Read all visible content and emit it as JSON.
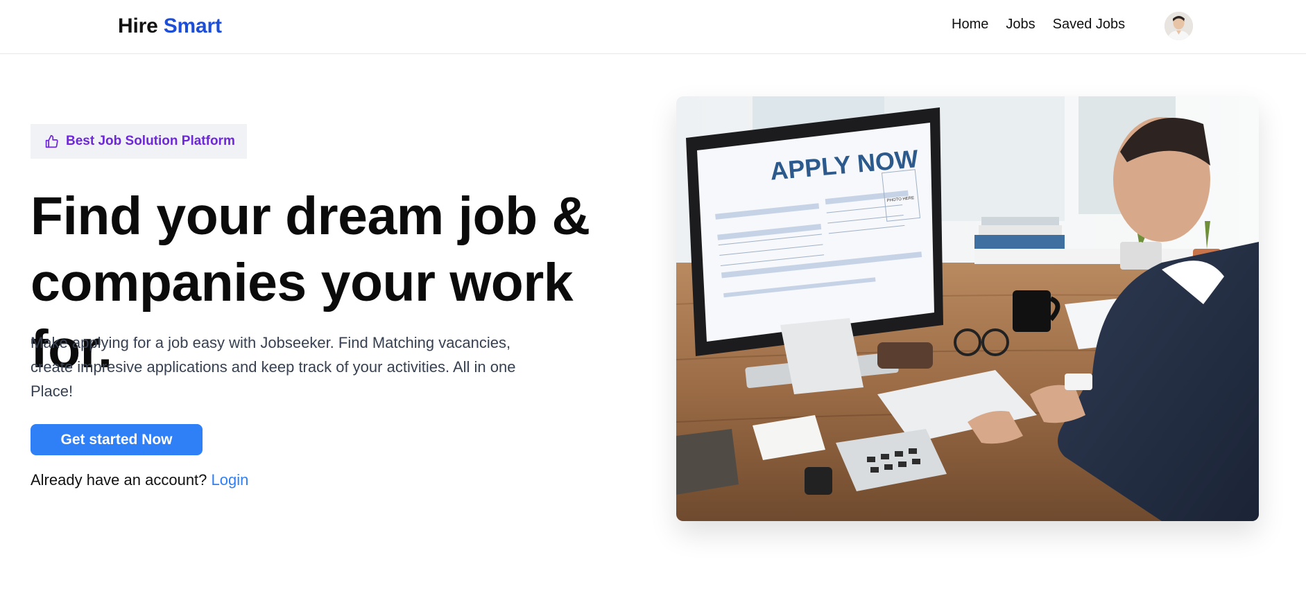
{
  "header": {
    "brand_part1": "Hire",
    "brand_part2": "Smart",
    "nav": [
      {
        "label": "Home"
      },
      {
        "label": "Jobs"
      },
      {
        "label": "Saved Jobs"
      }
    ],
    "avatar_icon": "user-avatar-icon"
  },
  "hero": {
    "badge_icon": "thumbs-up-icon",
    "badge_label": "Best Job Solution Platform",
    "headline_line1": "Find your dream job &",
    "headline_line2": "companies your work for.",
    "description": "Make applying for a job easy with Jobseeker. Find Matching vacancies, create impresive applications and keep track of your activities. All in one Place!",
    "cta_label": "Get started Now",
    "login_prompt": "Already have an account?",
    "login_link": "Login",
    "image": {
      "monitor_heading": "APPLY NOW",
      "form_photo_label": "PHOTO HERE"
    }
  },
  "colors": {
    "brand_accent": "#1d4ed8",
    "badge_text": "#6d28d9",
    "cta": "#2f7ff7",
    "link": "#2f7ff7"
  }
}
